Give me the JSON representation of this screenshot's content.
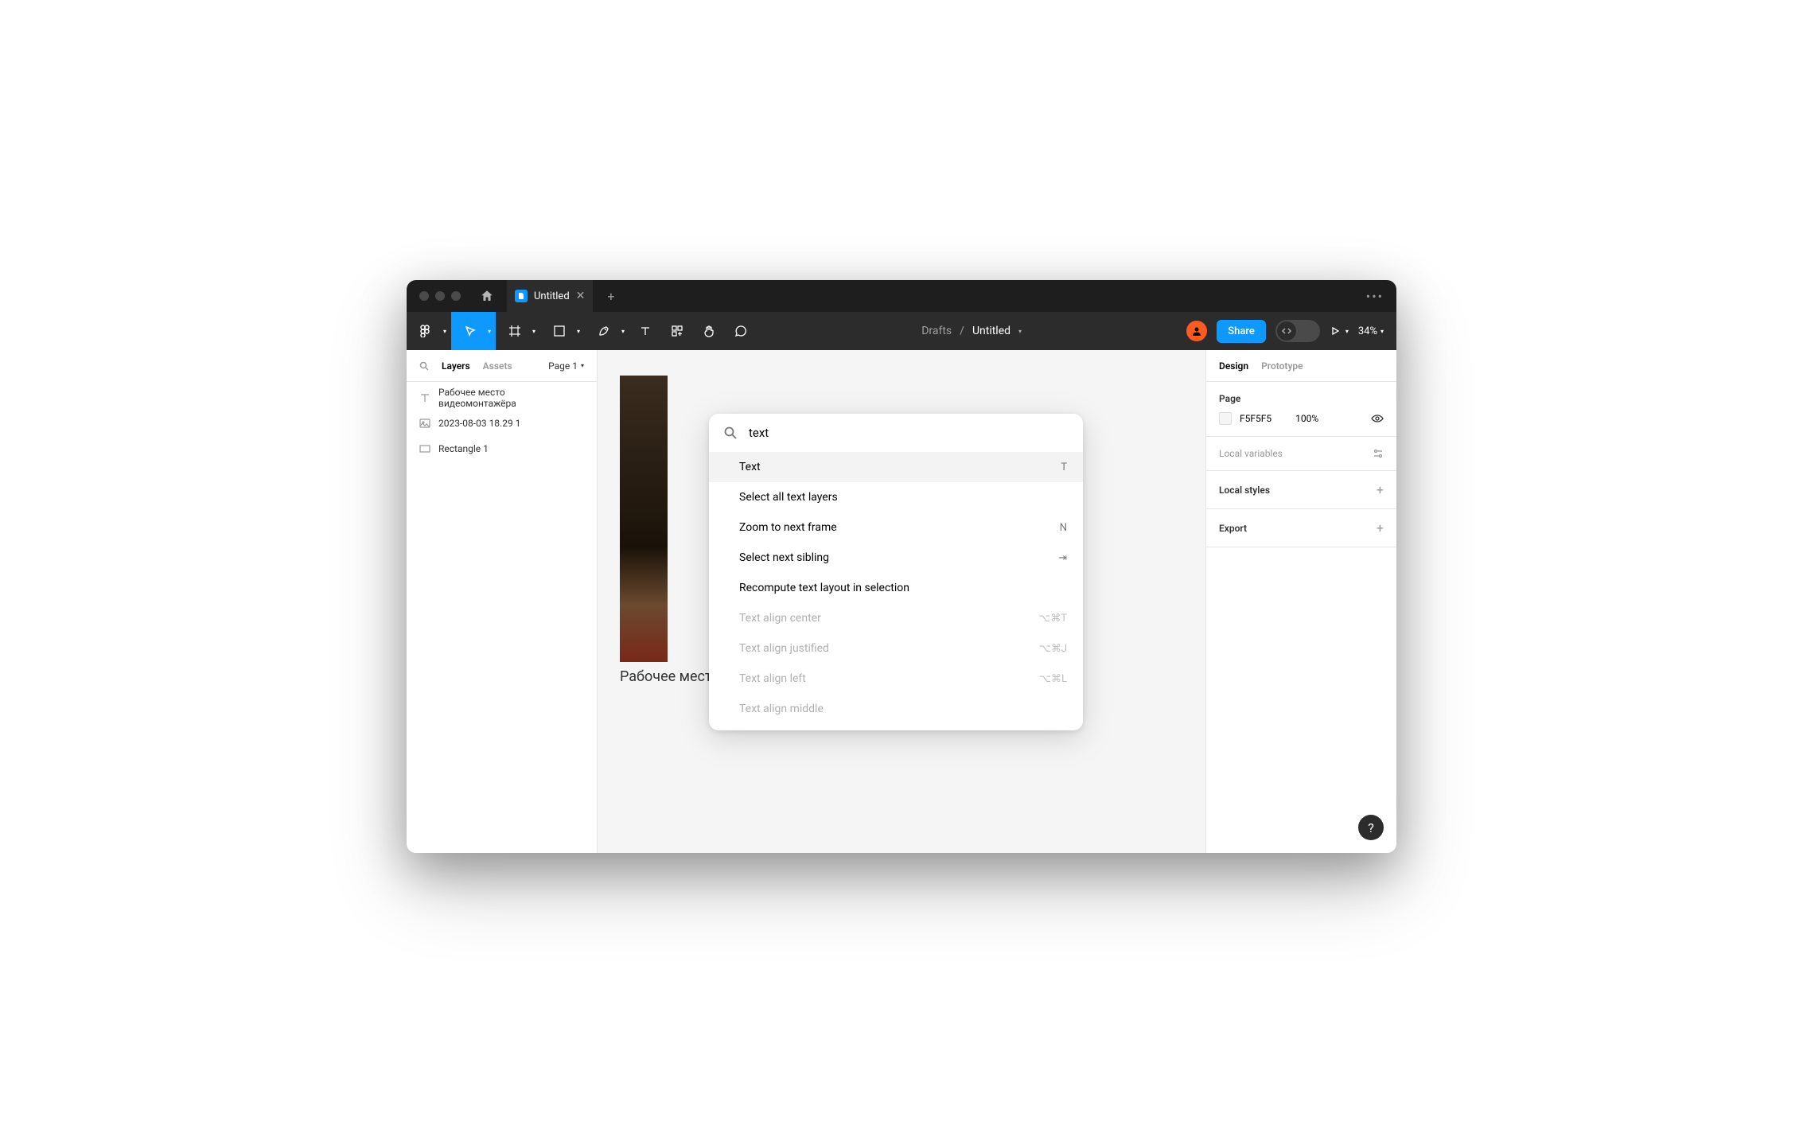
{
  "titlebar": {
    "tab_title": "Untitled"
  },
  "toolbar": {
    "breadcrumb_parent": "Drafts",
    "breadcrumb_separator": "/",
    "file_name": "Untitled",
    "share_label": "Share",
    "zoom": "34%"
  },
  "left_panel": {
    "tabs": {
      "layers": "Layers",
      "assets": "Assets"
    },
    "page_selector": "Page 1",
    "layers": [
      {
        "type": "text",
        "name": "Рабочее место видеомонтажёра"
      },
      {
        "type": "image",
        "name": "2023-08-03 18.29 1"
      },
      {
        "type": "rectangle",
        "name": "Rectangle 1"
      }
    ]
  },
  "canvas": {
    "text_layer": "Рабочее место видеомонтажера"
  },
  "right_panel": {
    "tabs": {
      "design": "Design",
      "prototype": "Prototype"
    },
    "page_section": "Page",
    "page_color": "F5F5F5",
    "page_opacity": "100%",
    "local_variables": "Local variables",
    "local_styles": "Local styles",
    "export": "Export"
  },
  "palette": {
    "query": "text",
    "items": [
      {
        "label": "Text",
        "shortcut": "T",
        "highlighted": true
      },
      {
        "label": "Select all text layers"
      },
      {
        "label": "Zoom to next frame",
        "shortcut": "N"
      },
      {
        "label": "Select next sibling",
        "shortcut": "⇥"
      },
      {
        "label": "Recompute text layout in selection"
      },
      {
        "label": "Text align center",
        "shortcut": "⌥⌘T",
        "disabled": true
      },
      {
        "label": "Text align justified",
        "shortcut": "⌥⌘J",
        "disabled": true
      },
      {
        "label": "Text align left",
        "shortcut": "⌥⌘L",
        "disabled": true
      },
      {
        "label": "Text align middle",
        "disabled": true
      }
    ]
  },
  "help": "?"
}
